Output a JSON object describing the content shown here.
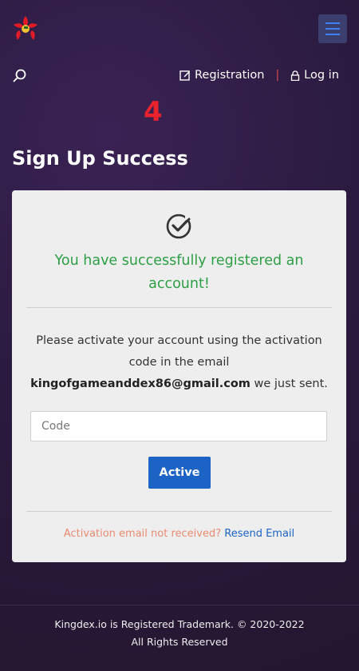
{
  "header": {
    "logo_icon": "red-star-flower-logo",
    "menu_icon": "hamburger-menu-icon",
    "search_icon": "search-icon",
    "nav": {
      "registration_label": "Registration",
      "registration_icon": "edit-icon",
      "separator": "|",
      "login_label": "Log in",
      "login_icon": "lock-icon"
    }
  },
  "step_marker": "4",
  "page_title": "Sign Up Success",
  "card": {
    "check_icon": "check-circle-icon",
    "success_message": "You have successfully registered an account!",
    "instruction_prefix": "Please activate your account using the activation code in the email",
    "email": "kingofgameanddex86@gmail.com",
    "instruction_suffix": "we just sent.",
    "code_placeholder": "Code",
    "code_value": "",
    "active_button": "Active",
    "resend_question": "Activation email not received?",
    "resend_link": "Resend Email"
  },
  "footer": {
    "line1": "Kingdex.io is Registered Trademark. © 2020-2022",
    "line2": "All Rights Reserved"
  },
  "colors": {
    "background": "#2a1a3f",
    "success_green": "#2c9f45",
    "primary_blue": "#1b63c5",
    "step_red": "#e8232d",
    "resend_orange": "#e98b72"
  }
}
